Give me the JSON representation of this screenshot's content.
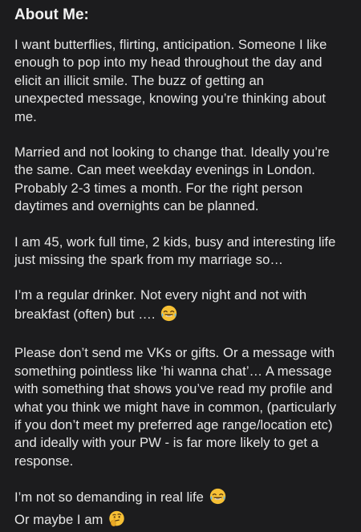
{
  "about": {
    "heading": "About Me:",
    "paragraphs": [
      {
        "lines": [
          "I want butterflies, flirting, anticipation. Someone I like",
          "enough to pop into my head throughout the day and",
          "elicit an illicit smile. The buzz of getting an",
          "unexpected message, knowing you’re thinking about",
          "me."
        ]
      },
      {
        "lines": [
          "Married and not looking to change that. Ideally you’re",
          "the same. Can meet weekday evenings in London.",
          "Probably 2-3 times a month. For the right person",
          "daytimes and overnights can be planned."
        ]
      },
      {
        "lines": [
          "I am 45, work full time, 2 kids, busy and interesting life",
          "just missing the spark from my marriage so…"
        ]
      },
      {
        "lines": [
          "I’m a regular drinker. Not every night and not with",
          "breakfast (often) but …. "
        ],
        "emoji": "face-with-tears-of-joy-icon"
      },
      {
        "lines": [
          "Please don’t send me VKs or gifts. Or a message with",
          "something pointless like ‘hi wanna chat’… A message",
          "with something that shows you’ve read my profile and",
          "what you think we might have in common, (particularly",
          "if you don’t meet my preferred age range/location etc)",
          "and ideally with your PW - is far more likely to get a",
          "response."
        ]
      },
      {
        "lines": [
          "I’m not so demanding in real life ",
          "Or maybe I am "
        ],
        "emojis": [
          "face-with-tears-of-joy-icon",
          "thinking-face-icon"
        ]
      }
    ]
  },
  "colors": {
    "background": "#1c1c1e",
    "text": "#e6e6e6",
    "emoji_yellow": "#f6c035"
  }
}
